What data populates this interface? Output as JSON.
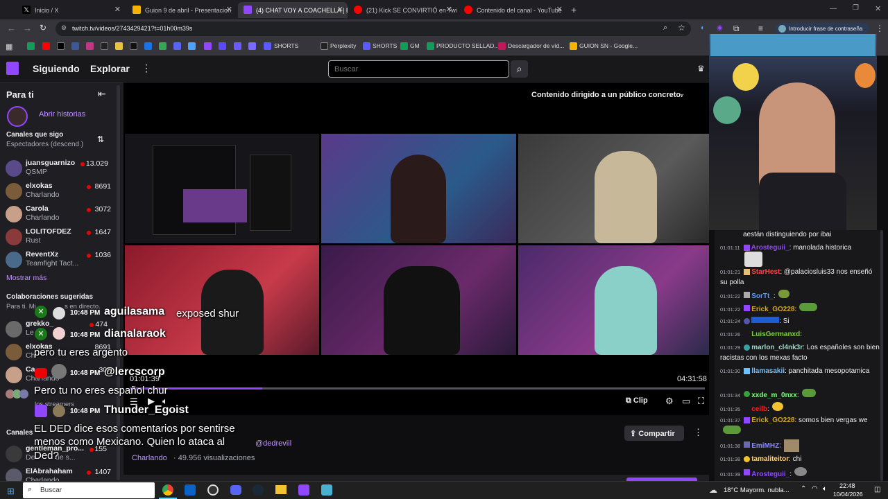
{
  "browser": {
    "tabs": [
      {
        "label": "Inicio / X",
        "color": "#000000"
      },
      {
        "label": "Guion 9 de abril - Presentacion",
        "color": "#f4b400"
      },
      {
        "label": "(4) CHAT VOY A COACHELLA | El",
        "color": "#9146ff",
        "active": true
      },
      {
        "label": "(21) Kick SE CONVIRTIÓ en Twitc",
        "color": "#ff0000"
      },
      {
        "label": "Contenido del canal - YouTube",
        "color": "#ff0000"
      }
    ],
    "new_tab": "+",
    "url": "twitch.tv/videos/2743429421?t=01h00m39s",
    "password_hint": "Introducir frase de contraseña",
    "bookmarks": [
      "SHORTS",
      "Perplexity",
      "SHORTS",
      "GM",
      "PRODUCTO SELLAD...",
      "Descargador de víd...",
      "GUION SN - Google..."
    ]
  },
  "twitch": {
    "nav": {
      "following": "Siguiendo",
      "explore": "Explorar",
      "search_placeholder": "Buscar"
    },
    "sidebar": {
      "for_you": "Para ti",
      "open_stories": "Abrir historias",
      "followed_title": "Canales que sigo",
      "followed_sort": "Espectadores (descend.)",
      "channels": [
        {
          "name": "juansguarnizo",
          "game": "QSMP",
          "viewers": "13.029",
          "color": "#5a4a8a"
        },
        {
          "name": "elxokas",
          "game": "Charlando",
          "viewers": "8691",
          "color": "#7a5c3a"
        },
        {
          "name": "Carola",
          "game": "Charlando",
          "viewers": "3072",
          "color": "#c8a08a"
        },
        {
          "name": "LOLITOFDEZ",
          "game": "Rust",
          "viewers": "1647",
          "color": "#8a3a3a"
        },
        {
          "name": "ReventXz",
          "game": "Teamfight Tact...",
          "viewers": "1036",
          "color": "#4a6a8a"
        }
      ],
      "show_more": "Mostrar más",
      "collab_title": "Colaboraciones sugeridas",
      "collab_sub_a": "Para ti. Mi",
      "collab_sub_b": "s en directo.",
      "collab": [
        {
          "name": "grekko_",
          "game": "Le",
          "viewers": "474"
        },
        {
          "name": "elxokas",
          "game": "Ch",
          "viewers": "8691"
        },
        {
          "name": "Ca",
          "game": "Charlando",
          "viewers": "307"
        }
      ],
      "streamers_text": "los streamers",
      "channels_title": "Canales",
      "bottom": [
        {
          "name": "gentleman_pro...",
          "game": "De",
          "game_tail": "de s...",
          "viewers": "155"
        },
        {
          "name": "ElAbrahaham",
          "game": "Charlando",
          "viewers": "1407"
        }
      ]
    },
    "player": {
      "audience_notice": "Contenido dirigido a un público concreto.",
      "current_time": "01:01:39",
      "duration": "04:31:58",
      "clip": "Clip",
      "progress": 0.2305
    },
    "video_info": {
      "category": "Charlando",
      "views": "49.956 visualizaciones",
      "share": "Compartir",
      "mention": "@dedreviil"
    }
  },
  "overlay": [
    {
      "time": "10:48 PM",
      "user": "aguilasama",
      "msg": "exposed shur"
    },
    {
      "time": "10:48 PM",
      "user": "dianalaraok",
      "msg": "pero tu eres argento"
    },
    {
      "time": "10:48 PM",
      "user": "@lercscorp",
      "msg": "Pero tu no eres español chur"
    },
    {
      "time": "10:48 PM",
      "user": "Thunder_Egoist",
      "msg_a": "EL DED dice esos comentarios por sentirse",
      "msg_b": "menos como Mexicano. Quien lo ataca al",
      "msg_c": "Ded?"
    }
  ],
  "chat": {
    "top_text": "aestán distinguiendo por ibai",
    "messages": [
      {
        "ts": "01:01:11",
        "user": "Arosteguii_",
        "color": "#9146ff",
        "text": ": manolada historica"
      },
      {
        "ts": "01:01:21",
        "user": "StarHest",
        "color": "#ff4545",
        "text": ": @palaciosluis33 nos enseñó su polla"
      },
      {
        "ts": "01:01:22",
        "user": "SorTt_",
        "color": "#5b99ff",
        "text": ":"
      },
      {
        "ts": "01:01:22",
        "user": "Erick_GO228",
        "color": "#daa520",
        "text": ":"
      },
      {
        "ts": "01:01:24",
        "user": "",
        "color": "#1e5bd6",
        "text": ": Si"
      },
      {
        "ts": "01:01:26",
        "user": "LuisGermanxd",
        "color": "#7fcf3f",
        "text": ":"
      },
      {
        "ts": "01:01:29",
        "user": "marlon_cl4nk3r",
        "color": "#9fd7c7",
        "text": ": Los españoles son bien racistas con los mexas facto"
      },
      {
        "ts": "01:01:30",
        "user": "llamasakii",
        "color": "#6ec1ff",
        "text": ": panchitada mesopotamica"
      },
      {
        "ts": "01:01:34",
        "user": "xxde_m_0nxx",
        "color": "#7fff7f",
        "text": ":"
      },
      {
        "ts": "01:01:35",
        "user": "ceilb",
        "color": "#ff2020",
        "text": ":"
      },
      {
        "ts": "01:01:37",
        "user": "Erick_GO228",
        "color": "#daa520",
        "text": ": somos bien vergas we"
      },
      {
        "ts": "01:01:38",
        "user": "EmiMHZ",
        "color": "#8a8aff",
        "text": ":"
      },
      {
        "ts": "01:01:38",
        "user": "tamaliteitor",
        "color": "#ffd27f",
        "text": ": chi"
      },
      {
        "ts": "01:01:39",
        "user": "Arosteguii_",
        "color": "#9146ff",
        "text": ":"
      }
    ]
  },
  "taskbar": {
    "search": "Buscar",
    "weather": "18°C  Mayorm. nubla...",
    "time": "22:48",
    "date": "10/04/2026"
  }
}
